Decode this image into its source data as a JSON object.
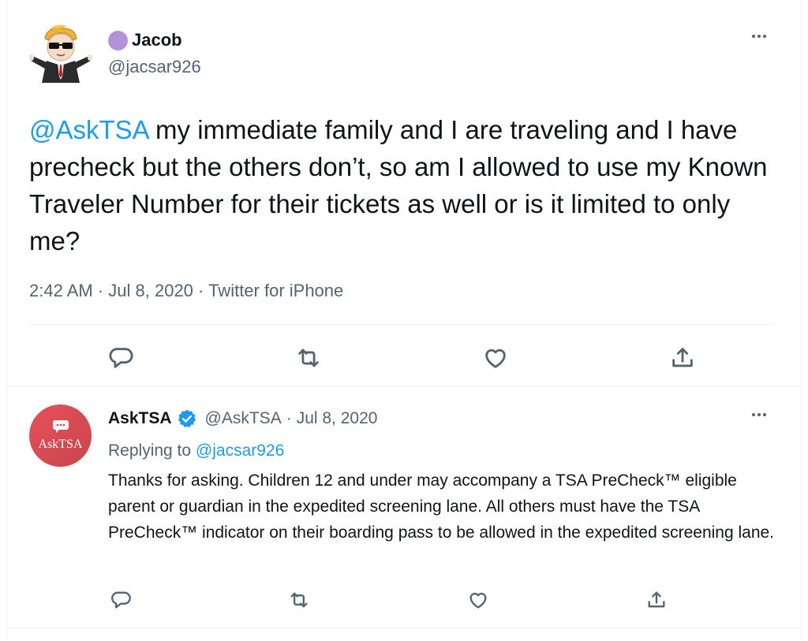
{
  "main_tweet": {
    "display_name": "Jacob",
    "handle": "@jacsar926",
    "text_mention": "@AskTSA",
    "text_body": " my immediate family and I are traveling and I have precheck but the others don’t, so am I allowed to use my Known Traveler Number for their tickets as well or is it limited to only me?",
    "time": "2:42 AM",
    "date": "Jul 8, 2020",
    "source": "Twitter for iPhone",
    "meta_separator": " · ",
    "name_badge_color": "#b392d9",
    "avatar_icon": "stonks-man-sunglasses-avatar"
  },
  "reply_tweet": {
    "display_name": "AskTSA",
    "handle": "@AskTSA",
    "separator": "·",
    "date": "Jul 8, 2020",
    "replying_prefix": "Replying to ",
    "replying_to": "@jacsar926",
    "avatar_label": "AskTSA",
    "avatar_icon": "chat-bubble-icon",
    "verified_icon": "verified-badge-icon",
    "text": "Thanks for asking. Children 12 and under may accompany a TSA PreCheck™ eligible parent or guardian in the expedited screening lane. All others must have the TSA PreCheck™ indicator on their boarding pass to be allowed in the expedited screening lane."
  },
  "actions": {
    "icons": [
      "reply-icon",
      "retweet-icon",
      "like-icon",
      "share-icon"
    ]
  },
  "colors": {
    "link": "#1d9bf0",
    "secondary_text": "#536471",
    "primary_text": "#0f1419",
    "verified": "#1d9bf0",
    "tsa_avatar": "#d44a52"
  }
}
